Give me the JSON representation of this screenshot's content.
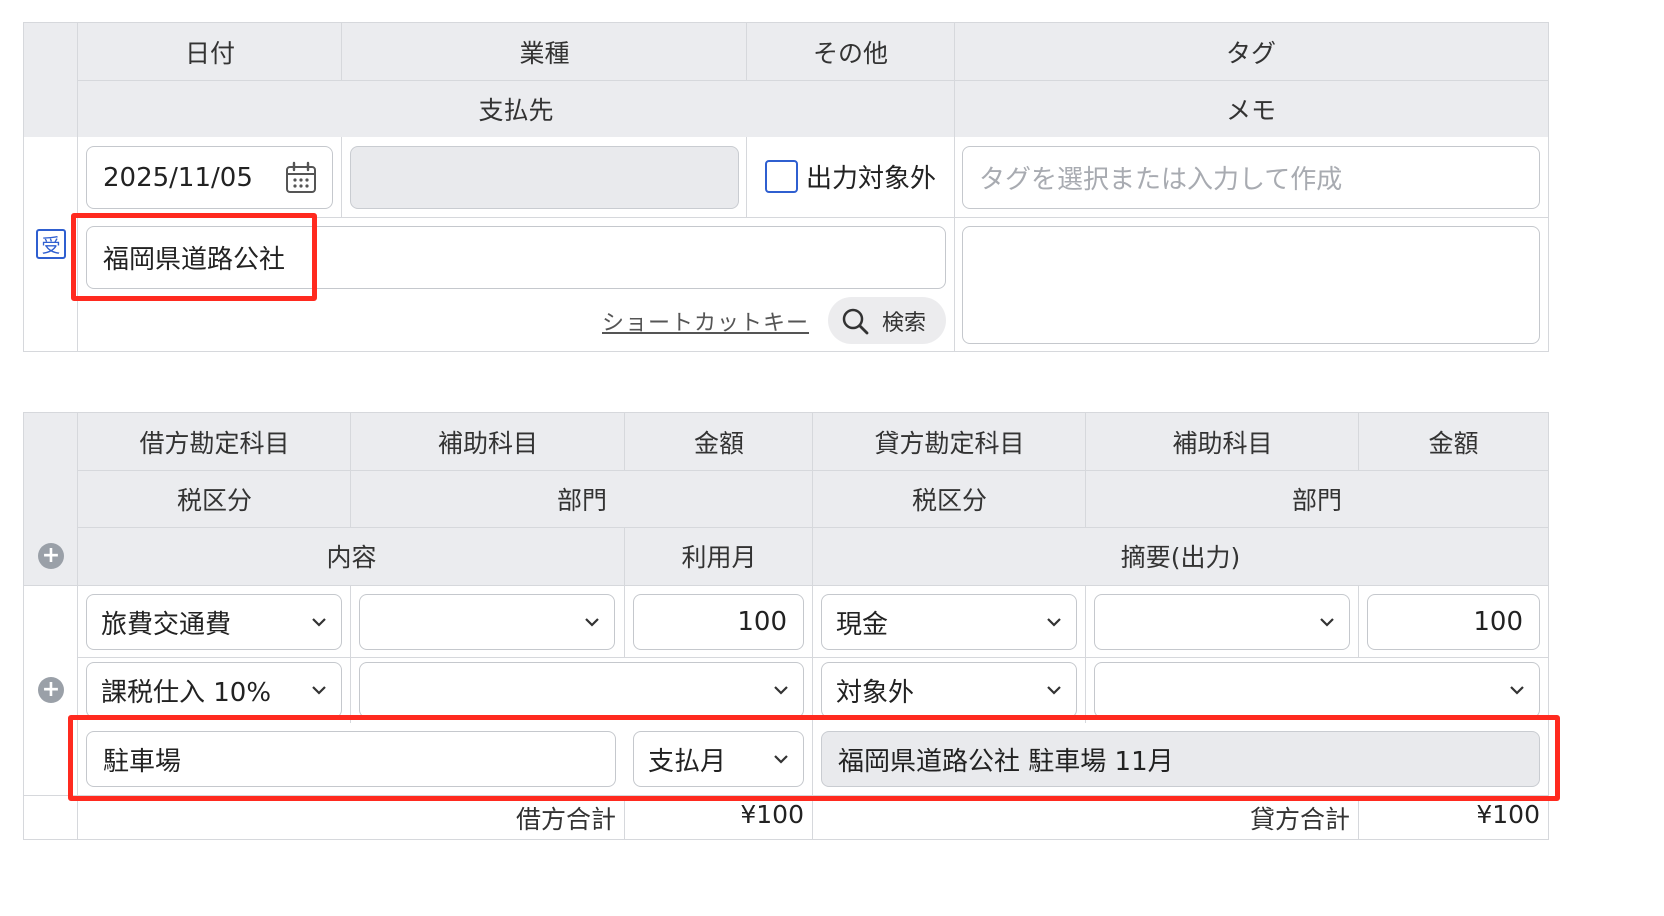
{
  "entry": {
    "headers": {
      "date": "日付",
      "industry": "業種",
      "other": "その他",
      "tag": "タグ",
      "payee": "支払先",
      "memo": "メモ"
    },
    "receipt_badge": "受",
    "date_value": "2025/11/05",
    "industry_value": "",
    "exclude_label": "出力対象外",
    "tag_placeholder": "タグを選択または入力して作成",
    "payee_value": "福岡県道路公社",
    "memo_value": "",
    "shortcut_link": "ショートカットキー",
    "search_label": "検索"
  },
  "journal": {
    "headers": {
      "debit_account": "借方勘定科目",
      "debit_sub": "補助科目",
      "debit_amount": "金額",
      "credit_account": "貸方勘定科目",
      "credit_sub": "補助科目",
      "credit_amount": "金額",
      "debit_tax": "税区分",
      "debit_dept": "部門",
      "credit_tax": "税区分",
      "credit_dept": "部門",
      "content": "内容",
      "usage_month": "利用月",
      "summary": "摘要(出力)"
    },
    "row": {
      "debit_account": "旅費交通費",
      "debit_sub": "",
      "debit_amount": "100",
      "credit_account": "現金",
      "credit_sub": "",
      "credit_amount": "100",
      "debit_tax": "課税仕入 10%",
      "debit_dept": "",
      "credit_tax": "対象外",
      "credit_dept": "",
      "content": "駐車場",
      "usage_month": "支払月",
      "summary": "福岡県道路公社 駐車場 11月"
    },
    "totals": {
      "debit_label": "借方合計",
      "debit_value": "¥100",
      "credit_label": "貸方合計",
      "credit_value": "¥100"
    }
  },
  "colors": {
    "header_bg": "#ebecef",
    "highlight": "#ff2a1f",
    "accent": "#2f5fd0"
  }
}
